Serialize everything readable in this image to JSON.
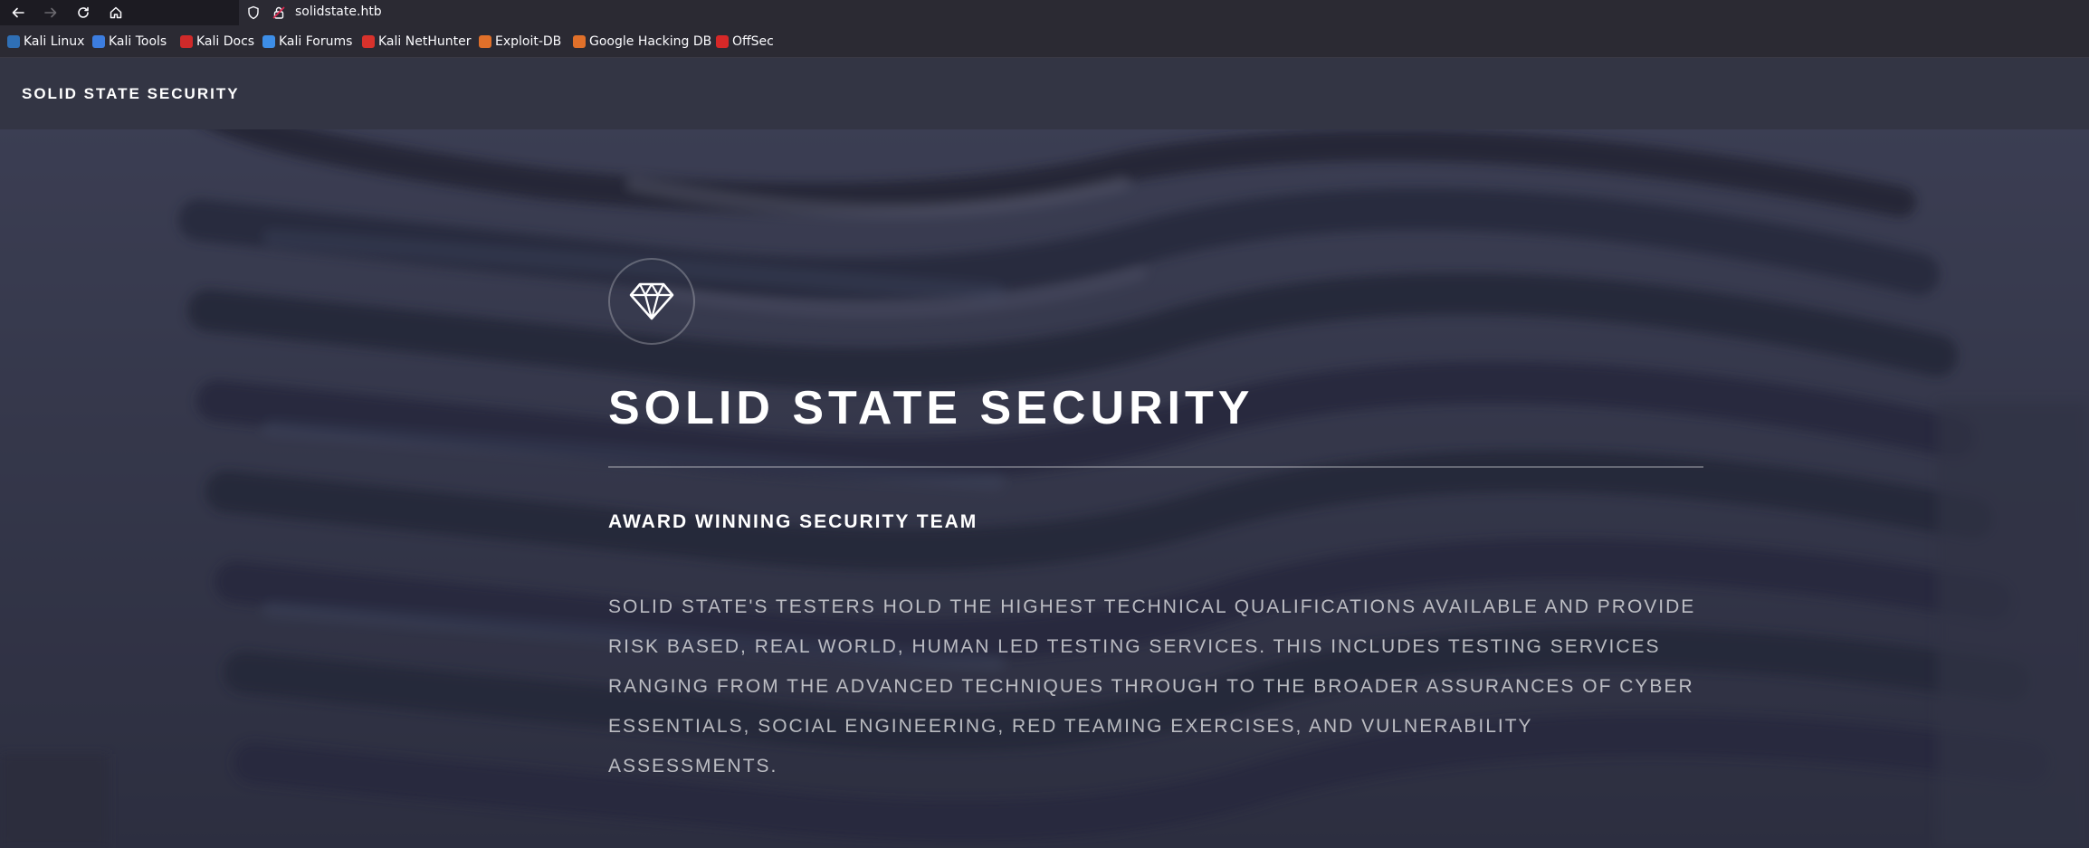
{
  "browser": {
    "url": "solidstate.htb",
    "bookmarks": [
      {
        "label": "Kali Linux",
        "color": "#2f6fb5"
      },
      {
        "label": "Kali Tools",
        "color": "#3c7de0"
      },
      {
        "label": "Kali Docs",
        "color": "#d02a2a"
      },
      {
        "label": "Kali Forums",
        "color": "#3d8ee8"
      },
      {
        "label": "Kali NetHunter",
        "color": "#d8322c"
      },
      {
        "label": "Exploit-DB",
        "color": "#e0702a"
      },
      {
        "label": "Google Hacking DB",
        "color": "#e0702a"
      },
      {
        "label": "OffSec",
        "color": "#d62828"
      }
    ]
  },
  "site": {
    "header": {
      "logo": "SOLID STATE SECURITY"
    },
    "banner": {
      "icon": "diamond-icon",
      "title": "SOLID STATE SECURITY",
      "subtitle": "AWARD WINNING SECURITY TEAM",
      "text": "SOLID STATE'S TESTERS HOLD THE HIGHEST TECHNICAL QUALIFICATIONS AVAILABLE AND PROVIDE RISK BASED, REAL WORLD, HUMAN LED TESTING SERVICES. THIS INCLUDES TESTING SERVICES RANGING FROM THE ADVANCED TECHNIQUES THROUGH TO THE BROADER ASSURANCES OF CYBER ESSENTIALS, SOCIAL ENGINEERING, RED TEAMING EXERCISES, AND VULNERABILITY ASSESSMENTS."
    }
  }
}
